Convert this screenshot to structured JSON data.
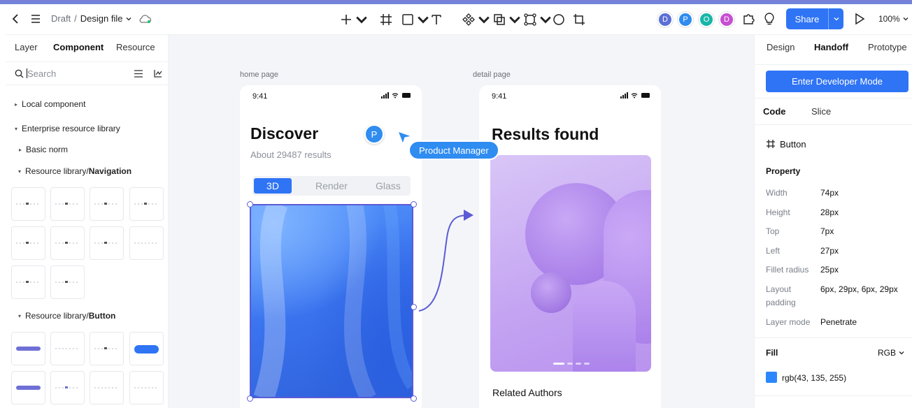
{
  "topbar": {
    "breadcrumb_draft": "Draft",
    "breadcrumb_sep": "/",
    "breadcrumb_file": "Design file",
    "share_label": "Share",
    "zoom": "100%",
    "collaborators": [
      {
        "initial": "D",
        "color": "#5b6fd6"
      },
      {
        "initial": "P",
        "color": "#2f8cf0"
      },
      {
        "initial": "O",
        "color": "#18b6a8"
      },
      {
        "initial": "D",
        "color": "#c64fd1"
      }
    ]
  },
  "left": {
    "tabs": [
      "Layer",
      "Component",
      "Resource"
    ],
    "active_tab": "Component",
    "search_placeholder": "Search",
    "tree": {
      "local": "Local component",
      "enterprise": "Enterprise resource library",
      "basic": "Basic norm",
      "nav_prefix": "Resource library/",
      "nav_suffix": "Navigation",
      "btn_prefix": "Resource library/",
      "btn_suffix": "Button"
    }
  },
  "canvas": {
    "home_label": "home page",
    "detail_label": "detail page",
    "time": "9:41",
    "home": {
      "title": "Discover",
      "subtitle": "About 29487 results",
      "tabs": [
        "3D",
        "Render",
        "Glass"
      ]
    },
    "detail": {
      "title": "Results found",
      "related": "Related Authors"
    },
    "cursor_user_initial": "P",
    "cursor_tag": "Product Manager"
  },
  "right": {
    "tabs": [
      "Design",
      "Handoff",
      "Prototype"
    ],
    "active_tab": "Handoff",
    "dev_button": "Enter Developer Mode",
    "subtabs": [
      "Code",
      "Slice"
    ],
    "component_name": "Button",
    "property_heading": "Property",
    "properties": [
      {
        "key": "Width",
        "value": "74px"
      },
      {
        "key": "Height",
        "value": "28px"
      },
      {
        "key": "Top",
        "value": "7px"
      },
      {
        "key": "Left",
        "value": "27px"
      },
      {
        "key": "Fillet radius",
        "value": "25px"
      },
      {
        "key": "Layout padding",
        "value": "6px, 29px, 6px, 29px"
      },
      {
        "key": "Layer mode",
        "value": "Penetrate"
      }
    ],
    "fill_heading": "Fill",
    "fill_mode": "RGB",
    "fill_value": "rgb(43, 135, 255)",
    "fill_color": "#2b87ff"
  }
}
